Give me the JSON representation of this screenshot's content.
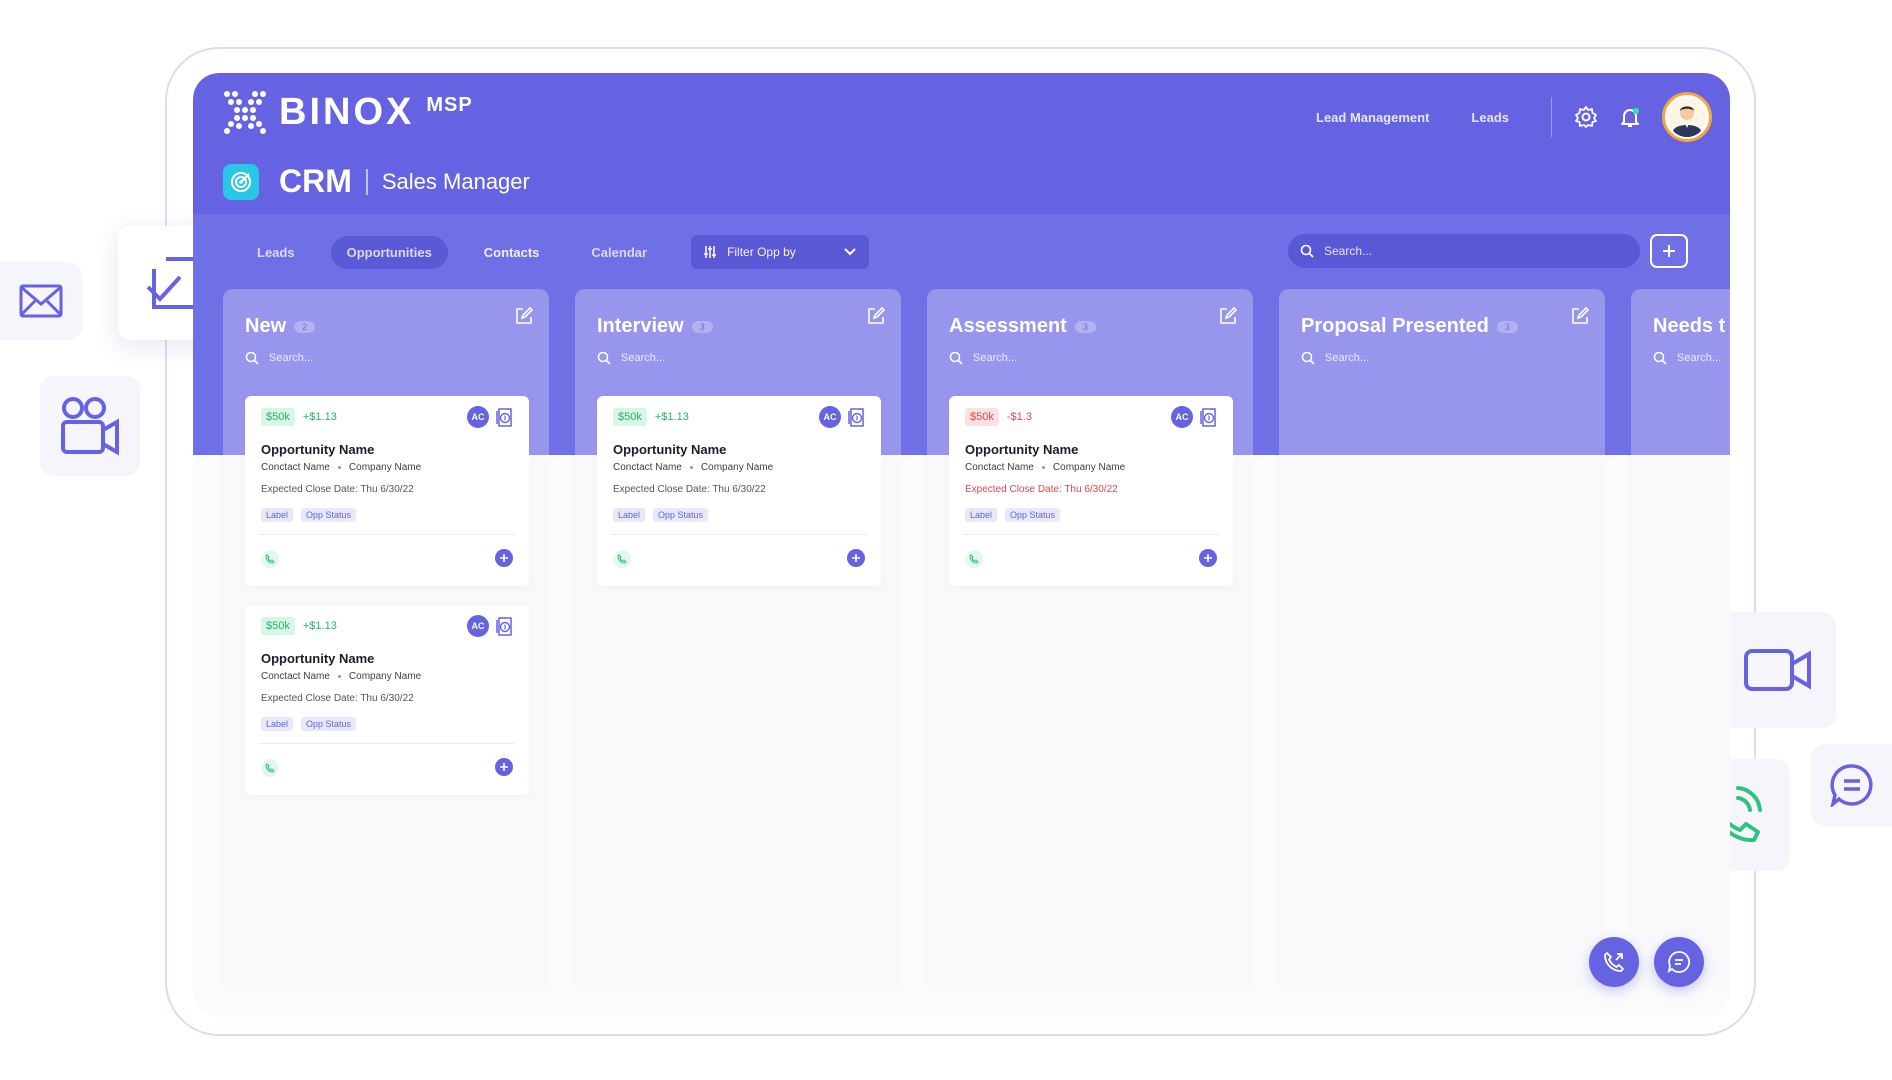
{
  "brand": {
    "name": "BINOX",
    "suffix": "MSP"
  },
  "header": {
    "nav": [
      "Lead Management",
      "Leads"
    ],
    "crm_title": "CRM",
    "crm_subtitle": "Sales Manager"
  },
  "tabs": [
    {
      "label": "Leads"
    },
    {
      "label": "Opportunities"
    },
    {
      "label": "Contacts"
    },
    {
      "label": "Calendar"
    }
  ],
  "filter": {
    "label": "Filter Opp by"
  },
  "search": {
    "placeholder": "Search..."
  },
  "columns": [
    {
      "title": "New",
      "count": "2",
      "search_placeholder": "Search...",
      "cards": [
        {
          "amount": "$50k",
          "delta": "+$1.13",
          "initials": "AC",
          "name": "Opportunity Name",
          "contact": "Conctact Name",
          "company": "Company Name",
          "date": "Expected Close Date: Thu 6/30/22",
          "label": "Label",
          "status": "Opp Status"
        },
        {
          "amount": "$50k",
          "delta": "+$1.13",
          "initials": "AC",
          "name": "Opportunity Name",
          "contact": "Conctact Name",
          "company": "Company Name",
          "date": "Expected Close Date: Thu 6/30/22",
          "label": "Label",
          "status": "Opp Status"
        }
      ]
    },
    {
      "title": "Interview",
      "count": "3",
      "search_placeholder": "Search...",
      "cards": [
        {
          "amount": "$50k",
          "delta": "+$1.13",
          "initials": "AC",
          "name": "Opportunity Name",
          "contact": "Conctact Name",
          "company": "Company Name",
          "date": "Expected Close Date: Thu 6/30/22",
          "label": "Label",
          "status": "Opp Status"
        }
      ]
    },
    {
      "title": "Assessment",
      "count": "3",
      "search_placeholder": "Search...",
      "cards": [
        {
          "amount": "$50k",
          "delta": "-$1.3",
          "initials": "AC",
          "name": "Opportunity Name",
          "contact": "Conctact Name",
          "company": "Company Name",
          "date": "Expected Close Date: Thu 6/30/22",
          "label": "Label",
          "status": "Opp Status"
        }
      ]
    },
    {
      "title": "Proposal Presented",
      "count": "3",
      "search_placeholder": "Search...",
      "cards": []
    },
    {
      "title": "Needs t",
      "search_placeholder": "Search...",
      "cards": []
    }
  ],
  "colors": {
    "primary": "#6563e1",
    "band": "#7070e6",
    "column_head": "#9795ec",
    "positive": "#26b26c",
    "negative": "#e3454c",
    "teal_badge": "#28c7e6",
    "avatar_ring": "#f2a83a"
  },
  "icons": {
    "floating": [
      "mail-icon",
      "checkbox-icon",
      "video-conference-icon",
      "video-camera-icon",
      "chat-icon",
      "phone-call-icon"
    ],
    "fabs": [
      "phone-outgoing-icon",
      "chat-icon"
    ]
  }
}
